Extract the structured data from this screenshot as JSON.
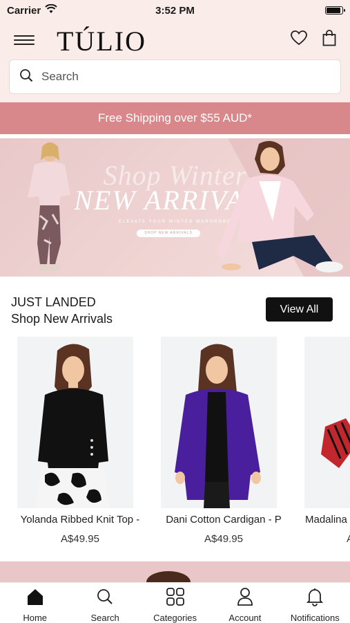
{
  "status_bar": {
    "carrier": "Carrier",
    "time": "3:52 PM"
  },
  "header": {
    "logo": "TÚLIO",
    "menu_icon": "hamburger-menu-icon",
    "wishlist_icon": "heart-icon",
    "bag_icon": "shopping-bag-icon",
    "search": {
      "placeholder": "Search",
      "value": ""
    }
  },
  "promo": {
    "text": "Free Shipping over $55 AUD*"
  },
  "hero": {
    "script_text": "Shop Winter",
    "title": "NEW ARRIVALS",
    "subtitle": "ELEVATE YOUR WINTER WARDROBE",
    "button_label": "SHOP NEW ARRIVALS"
  },
  "just_landed": {
    "eyebrow": "JUST LANDED",
    "heading": "Shop New Arrivals",
    "view_all_label": "View All"
  },
  "products": [
    {
      "name": "Yolanda Ribbed Knit Top -",
      "price": "A$49.95"
    },
    {
      "name": "Dani Cotton Cardigan - P",
      "price": "A$49.95"
    },
    {
      "name": "Madalina",
      "price": "A"
    }
  ],
  "tabs": [
    {
      "label": "Home",
      "icon": "home-icon"
    },
    {
      "label": "Search",
      "icon": "search-icon"
    },
    {
      "label": "Categories",
      "icon": "grid-icon"
    },
    {
      "label": "Account",
      "icon": "user-icon"
    },
    {
      "label": "Notifications",
      "icon": "bell-icon"
    }
  ],
  "colors": {
    "header_bg": "#f9ece9",
    "promo_bg": "#d8878a",
    "hero_bg": "#efd4d3",
    "button_bg": "#111111"
  }
}
